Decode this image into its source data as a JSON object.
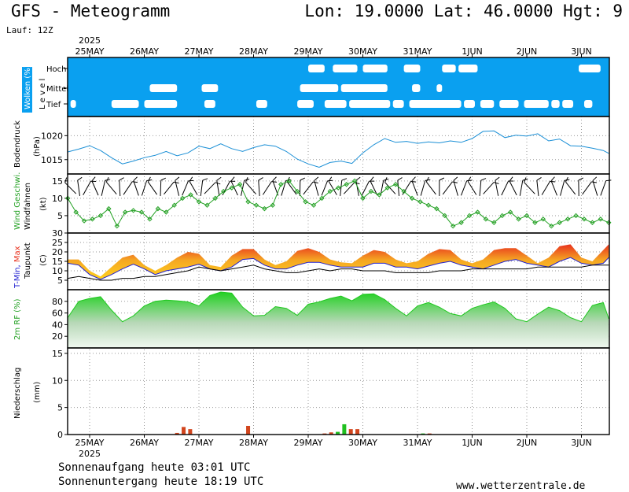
{
  "header": {
    "title": "GFS - Meteogramm",
    "coords": "Lon: 19.0000  Lat: 46.0000  Hgt: 9",
    "run": "Lauf: 12Z"
  },
  "footer": {
    "sunrise": "Sonnenaufgang heute 03:01 UTC",
    "sunset": "Sonnenuntergang heute 18:19 UTC",
    "credit": "www.wetterzentrale.de"
  },
  "chart_data": [
    {
      "type": "heatmap",
      "title": "",
      "ylabel": "Wolken (%)",
      "ylabel2": "L e v e l",
      "levels": [
        "Hoch",
        "Mittel",
        "Tief"
      ],
      "colors": {
        "bg": "#0aa0f0",
        "cloud": "#ffffff"
      },
      "days": [
        "25MAY",
        "26MAY",
        "27MAY",
        "28MAY",
        "29MAY",
        "30MAY",
        "31MAY",
        "1JUN",
        "2JUN",
        "3JUN"
      ],
      "year": "2025",
      "cloud_spans": {
        "Hoch": [
          [
            4.0,
            4.3
          ],
          [
            4.45,
            4.9
          ],
          [
            5.0,
            5.45
          ],
          [
            5.75,
            6.05
          ],
          [
            6.45,
            6.7
          ],
          [
            6.75,
            7.1
          ],
          [
            8.95,
            9.35
          ],
          [
            9.6,
            9.8
          ]
        ],
        "Mittel": [
          [
            1.1,
            1.6
          ],
          [
            2.05,
            2.35
          ],
          [
            3.85,
            4.55
          ],
          [
            4.6,
            5.45
          ],
          [
            5.9,
            6.05
          ],
          [
            6.35,
            6.45
          ]
        ],
        "Tief": [
          [
            -0.35,
            -0.25
          ],
          [
            0.4,
            0.9
          ],
          [
            1.0,
            1.6
          ],
          [
            2.1,
            2.3
          ],
          [
            3.05,
            3.25
          ],
          [
            3.8,
            4.1
          ],
          [
            4.3,
            4.7
          ],
          [
            4.75,
            5.5
          ],
          [
            5.55,
            5.75
          ],
          [
            5.85,
            6.8
          ],
          [
            6.85,
            7.05
          ],
          [
            7.15,
            7.4
          ],
          [
            7.5,
            7.85
          ],
          [
            7.95,
            8.4
          ],
          [
            8.45,
            8.6
          ],
          [
            8.65,
            8.85
          ],
          [
            9.05,
            9.2
          ]
        ]
      }
    },
    {
      "type": "line",
      "title": "",
      "ylabel": "Bodendruck",
      "unit": "(hPa)",
      "ylim": [
        1012,
        1024
      ],
      "yticks": [
        1015,
        1020
      ],
      "color": "#1a8fd6",
      "x": [
        -0.4,
        -0.2,
        0,
        0.2,
        0.4,
        0.6,
        0.8,
        1,
        1.2,
        1.4,
        1.6,
        1.8,
        2,
        2.2,
        2.4,
        2.6,
        2.8,
        3,
        3.2,
        3.4,
        3.6,
        3.8,
        4,
        4.2,
        4.4,
        4.6,
        4.8,
        5,
        5.2,
        5.4,
        5.6,
        5.8,
        6,
        6.2,
        6.4,
        6.6,
        6.8,
        7,
        7.2,
        7.4,
        7.6,
        7.8,
        8,
        8.2,
        8.4,
        8.6,
        8.8,
        9,
        9.2,
        9.4,
        9.5
      ],
      "values": [
        1016.6,
        1017.2,
        1017.9,
        1016.9,
        1015.4,
        1014.1,
        1014.7,
        1015.4,
        1015.9,
        1016.7,
        1015.8,
        1016.4,
        1017.8,
        1017.3,
        1018.3,
        1017.3,
        1016.7,
        1017.5,
        1018.1,
        1017.8,
        1016.7,
        1015.1,
        1014.1,
        1013.4,
        1014.4,
        1014.7,
        1014.2,
        1016.4,
        1018.1,
        1019.4,
        1018.6,
        1018.8,
        1018.4,
        1018.7,
        1018.5,
        1018.9,
        1018.6,
        1019.4,
        1020.9,
        1021.0,
        1019.6,
        1020.1,
        1019.9,
        1020.4,
        1018.9,
        1019.3,
        1017.9,
        1017.8,
        1017.4,
        1016.9,
        1016.3
      ]
    },
    {
      "type": "line",
      "title": "",
      "ylabel": "Wind Geschwi.",
      "ylabel2": "Windfahnen",
      "unit": "(kt)",
      "ylim": [
        0,
        17
      ],
      "yticks": [
        5,
        10,
        15
      ],
      "color": "#22a022",
      "x": [
        -0.4,
        -0.25,
        -0.1,
        0.05,
        0.2,
        0.35,
        0.5,
        0.65,
        0.8,
        0.95,
        1.1,
        1.25,
        1.4,
        1.55,
        1.7,
        1.85,
        2.0,
        2.15,
        2.3,
        2.45,
        2.6,
        2.75,
        2.9,
        3.05,
        3.2,
        3.35,
        3.5,
        3.65,
        3.8,
        3.95,
        4.1,
        4.25,
        4.4,
        4.55,
        4.7,
        4.85,
        5.0,
        5.15,
        5.3,
        5.45,
        5.6,
        5.75,
        5.9,
        6.05,
        6.2,
        6.35,
        6.5,
        6.65,
        6.8,
        6.95,
        7.1,
        7.25,
        7.4,
        7.55,
        7.7,
        7.85,
        8.0,
        8.15,
        8.3,
        8.45,
        8.6,
        8.75,
        8.9,
        9.05,
        9.2,
        9.35,
        9.5
      ],
      "values": [
        10,
        6,
        3.5,
        4,
        5,
        7,
        2,
        6,
        6.5,
        6,
        4,
        7,
        6,
        8,
        10,
        11,
        9,
        8,
        10,
        12,
        13,
        14,
        9,
        8,
        7,
        8,
        14,
        15,
        12,
        9,
        8,
        10,
        12,
        13,
        14,
        15,
        10,
        12,
        11,
        13,
        14,
        12,
        10,
        9,
        8,
        7,
        5,
        2,
        3,
        5,
        6,
        4,
        3,
        5,
        6,
        4,
        5,
        3,
        4,
        2,
        3,
        4,
        5,
        4,
        3,
        4,
        3
      ],
      "barb_x": [
        -0.35,
        -0.2,
        -0.05,
        0.1,
        0.25,
        0.4,
        0.55,
        0.7,
        0.85,
        1.0,
        1.15,
        1.3,
        1.45,
        1.6,
        1.75,
        1.9,
        2.05,
        2.2,
        2.35,
        2.5,
        2.65,
        2.8,
        2.95,
        3.1,
        3.25,
        3.4,
        3.55,
        3.7,
        3.85,
        4.0,
        4.15,
        4.3,
        4.45,
        4.6,
        4.75,
        4.9,
        5.05,
        5.2,
        5.35,
        5.5,
        5.65,
        5.8,
        5.95,
        6.1,
        6.25,
        6.4,
        6.55,
        6.7,
        6.85,
        7.0,
        7.15,
        7.3,
        7.45,
        7.6,
        7.75,
        7.9,
        8.05,
        8.2,
        8.35,
        8.5,
        8.65,
        8.8,
        8.95,
        9.1,
        9.25,
        9.4
      ]
    },
    {
      "type": "area",
      "title": "",
      "ylabel": "T-Min, Max",
      "ylabel2": "Taupunkt",
      "unit": "(C)",
      "ylim": [
        0,
        30
      ],
      "yticks": [
        5,
        10,
        15,
        20,
        25,
        30
      ],
      "colors": {
        "max": "#e8321e",
        "mid": "#f5a623",
        "min": "#ffd21e",
        "dew": "#000000",
        "tmin": "#2020d0"
      },
      "x": [
        -0.4,
        -0.2,
        0,
        0.2,
        0.4,
        0.6,
        0.8,
        1,
        1.2,
        1.4,
        1.6,
        1.8,
        2,
        2.2,
        2.4,
        2.6,
        2.8,
        3,
        3.2,
        3.4,
        3.6,
        3.8,
        4,
        4.2,
        4.4,
        4.6,
        4.8,
        5,
        5.2,
        5.4,
        5.6,
        5.8,
        6,
        6.2,
        6.4,
        6.6,
        6.8,
        7,
        7.2,
        7.4,
        7.6,
        7.8,
        8,
        8.2,
        8.4,
        8.6,
        8.8,
        9,
        9.2,
        9.4,
        9.5
      ],
      "tmax": [
        16,
        16,
        10,
        7,
        12,
        17,
        18.5,
        13,
        10,
        13,
        17,
        20,
        19,
        13,
        12,
        18,
        21.5,
        21.5,
        16,
        13,
        15,
        20.5,
        22,
        20,
        16,
        14.5,
        14,
        18,
        21,
        20,
        16,
        14,
        15,
        19,
        21.5,
        21,
        16,
        14,
        16,
        21,
        22,
        22,
        18,
        14,
        17,
        23,
        24,
        17,
        15,
        21,
        24
      ],
      "tmin": [
        14,
        13,
        8,
        5.5,
        8,
        11,
        13.5,
        11,
        8,
        10,
        11,
        12,
        13.5,
        11,
        10,
        12,
        16,
        16.5,
        13,
        11,
        11,
        13,
        14.5,
        14.5,
        13,
        12,
        12,
        12,
        14,
        14,
        12,
        12,
        11,
        12.5,
        14,
        15,
        13,
        12,
        11,
        13,
        15,
        16,
        14,
        13,
        12,
        15,
        17,
        14,
        13,
        14,
        17
      ],
      "dew": [
        6,
        7,
        6,
        5,
        5,
        6,
        6,
        7,
        7,
        8,
        9,
        10,
        12,
        11,
        10,
        11,
        12,
        13,
        11,
        10,
        9,
        9,
        10,
        11,
        10,
        11,
        11,
        10,
        10,
        10,
        9,
        9,
        9,
        9,
        10,
        10,
        10,
        11,
        11,
        11,
        11,
        11,
        11,
        12,
        12,
        12,
        12,
        12,
        13,
        13,
        13
      ]
    },
    {
      "type": "area",
      "title": "",
      "ylabel": "2m RF (%)",
      "ylim": [
        0,
        100
      ],
      "yticks": [
        20,
        40,
        60,
        80
      ],
      "color": "#20c820",
      "x": [
        -0.4,
        -0.2,
        0,
        0.2,
        0.4,
        0.6,
        0.8,
        1,
        1.2,
        1.4,
        1.6,
        1.8,
        2,
        2.2,
        2.4,
        2.6,
        2.8,
        3,
        3.2,
        3.4,
        3.6,
        3.8,
        4,
        4.2,
        4.4,
        4.6,
        4.8,
        5,
        5.2,
        5.4,
        5.6,
        5.8,
        6,
        6.2,
        6.4,
        6.6,
        6.8,
        7,
        7.2,
        7.4,
        7.6,
        7.8,
        8,
        8.2,
        8.4,
        8.6,
        8.8,
        9,
        9.2,
        9.4,
        9.5
      ],
      "values": [
        52,
        80,
        85,
        88,
        65,
        45,
        55,
        72,
        80,
        82,
        81,
        79,
        72,
        90,
        96,
        94,
        70,
        55,
        56,
        71,
        68,
        56,
        75,
        79,
        85,
        89,
        81,
        92,
        93,
        83,
        68,
        55,
        72,
        78,
        70,
        59,
        55,
        68,
        74,
        79,
        68,
        50,
        45,
        58,
        70,
        64,
        52,
        45,
        73,
        78,
        50
      ]
    },
    {
      "type": "bar",
      "title": "",
      "ylabel": "Niederschlag",
      "unit": "(mm)",
      "ylim": [
        0,
        16
      ],
      "yticks": [
        0,
        5,
        10,
        15
      ],
      "colors": {
        "rain": "#d2461e",
        "shower": "#20c020"
      },
      "bars": [
        {
          "x": 1.6,
          "value": 0.3,
          "kind": "rain"
        },
        {
          "x": 1.72,
          "value": 1.4,
          "kind": "rain"
        },
        {
          "x": 1.84,
          "value": 1.0,
          "kind": "rain"
        },
        {
          "x": 2.9,
          "value": 1.6,
          "kind": "rain"
        },
        {
          "x": 4.3,
          "value": 0.2,
          "kind": "rain"
        },
        {
          "x": 4.42,
          "value": 0.4,
          "kind": "rain"
        },
        {
          "x": 4.54,
          "value": 0.5,
          "kind": "shower"
        },
        {
          "x": 4.66,
          "value": 1.9,
          "kind": "shower"
        },
        {
          "x": 4.78,
          "value": 1.0,
          "kind": "rain"
        },
        {
          "x": 4.9,
          "value": 1.0,
          "kind": "rain"
        },
        {
          "x": 6.1,
          "value": 0.2,
          "kind": "shower"
        },
        {
          "x": 6.22,
          "value": 0.2,
          "kind": "rain"
        }
      ]
    }
  ]
}
